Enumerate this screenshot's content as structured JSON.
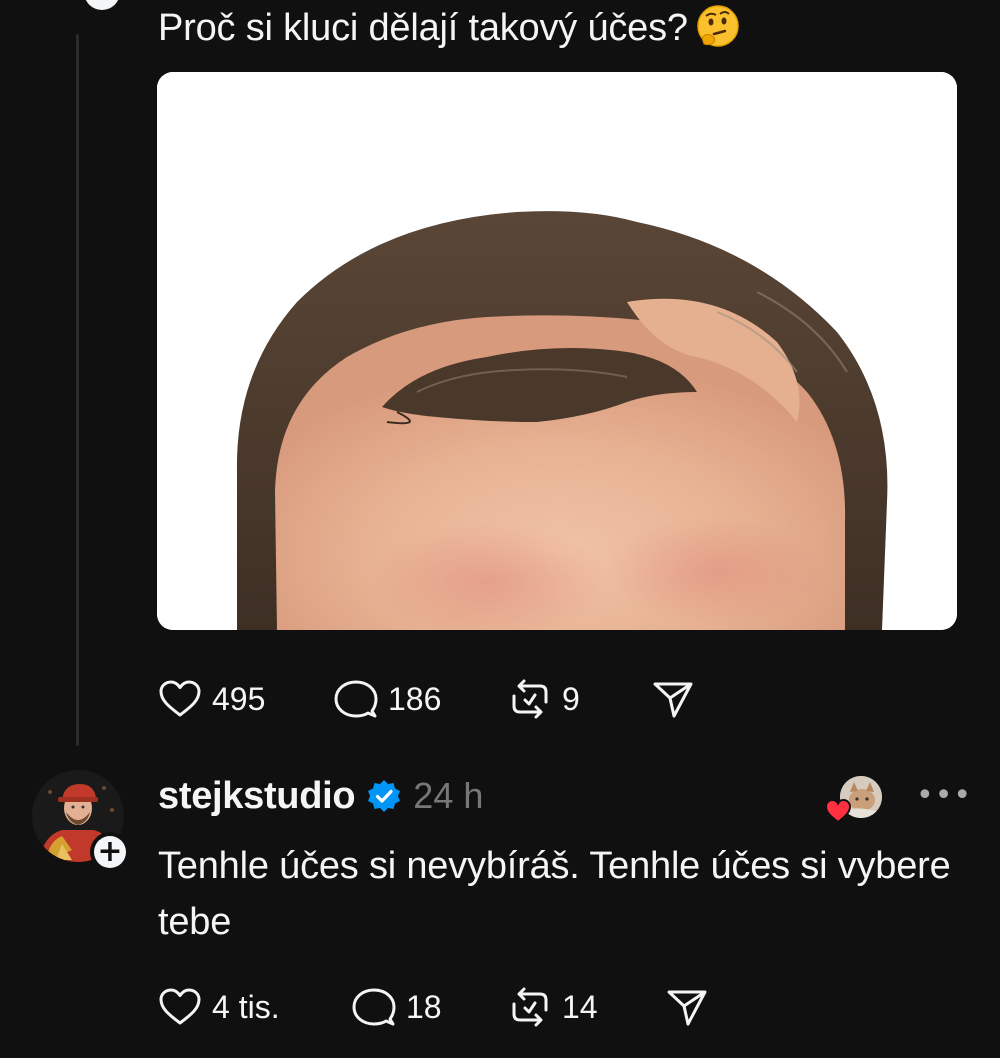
{
  "post": {
    "text": "Proč si kluci dělají takový účes?",
    "emoji": "thinking-face-emoji",
    "actions": {
      "likes": "495",
      "comments": "186",
      "reposts": "9"
    }
  },
  "reply": {
    "username": "stejkstudio",
    "verified": true,
    "time": "24 h",
    "text": "Tenhle účes si nevybíráš. Tenhle účes si vybere tebe",
    "more": "•••",
    "follow_symbol": "+",
    "actions": {
      "likes": "4 tis.",
      "comments": "18",
      "reposts": "14"
    }
  },
  "colors": {
    "background": "#101010",
    "text": "#f3f5f7",
    "muted": "#777777",
    "verified": "#0095f6",
    "heart": "#ff3040"
  }
}
